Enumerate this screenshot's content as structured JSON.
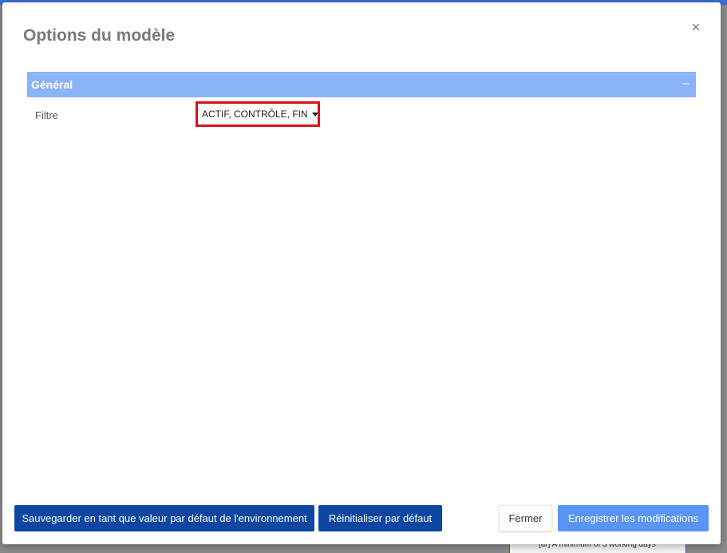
{
  "dialog": {
    "title": "Options du modèle",
    "close_glyph": "×"
  },
  "section": {
    "title": "Général",
    "collapse_glyph": "–"
  },
  "filter": {
    "label": "Filtre",
    "value": "ACTIF, CONTRÔLE, FIN"
  },
  "buttons": {
    "save_default": "Sauvegarder en tant que valeur par défaut de l'environnement",
    "reset": "Réinitialiser par défaut",
    "close": "Fermer",
    "save": "Enregistrer les modifications"
  },
  "background": {
    "note_text": "[ar] A minimum of 3 working days"
  },
  "colors": {
    "section_header": "#8ab4f8",
    "highlight_border": "#d8111b",
    "dark_button": "#0d47a1",
    "primary_button": "#5a95f5"
  }
}
